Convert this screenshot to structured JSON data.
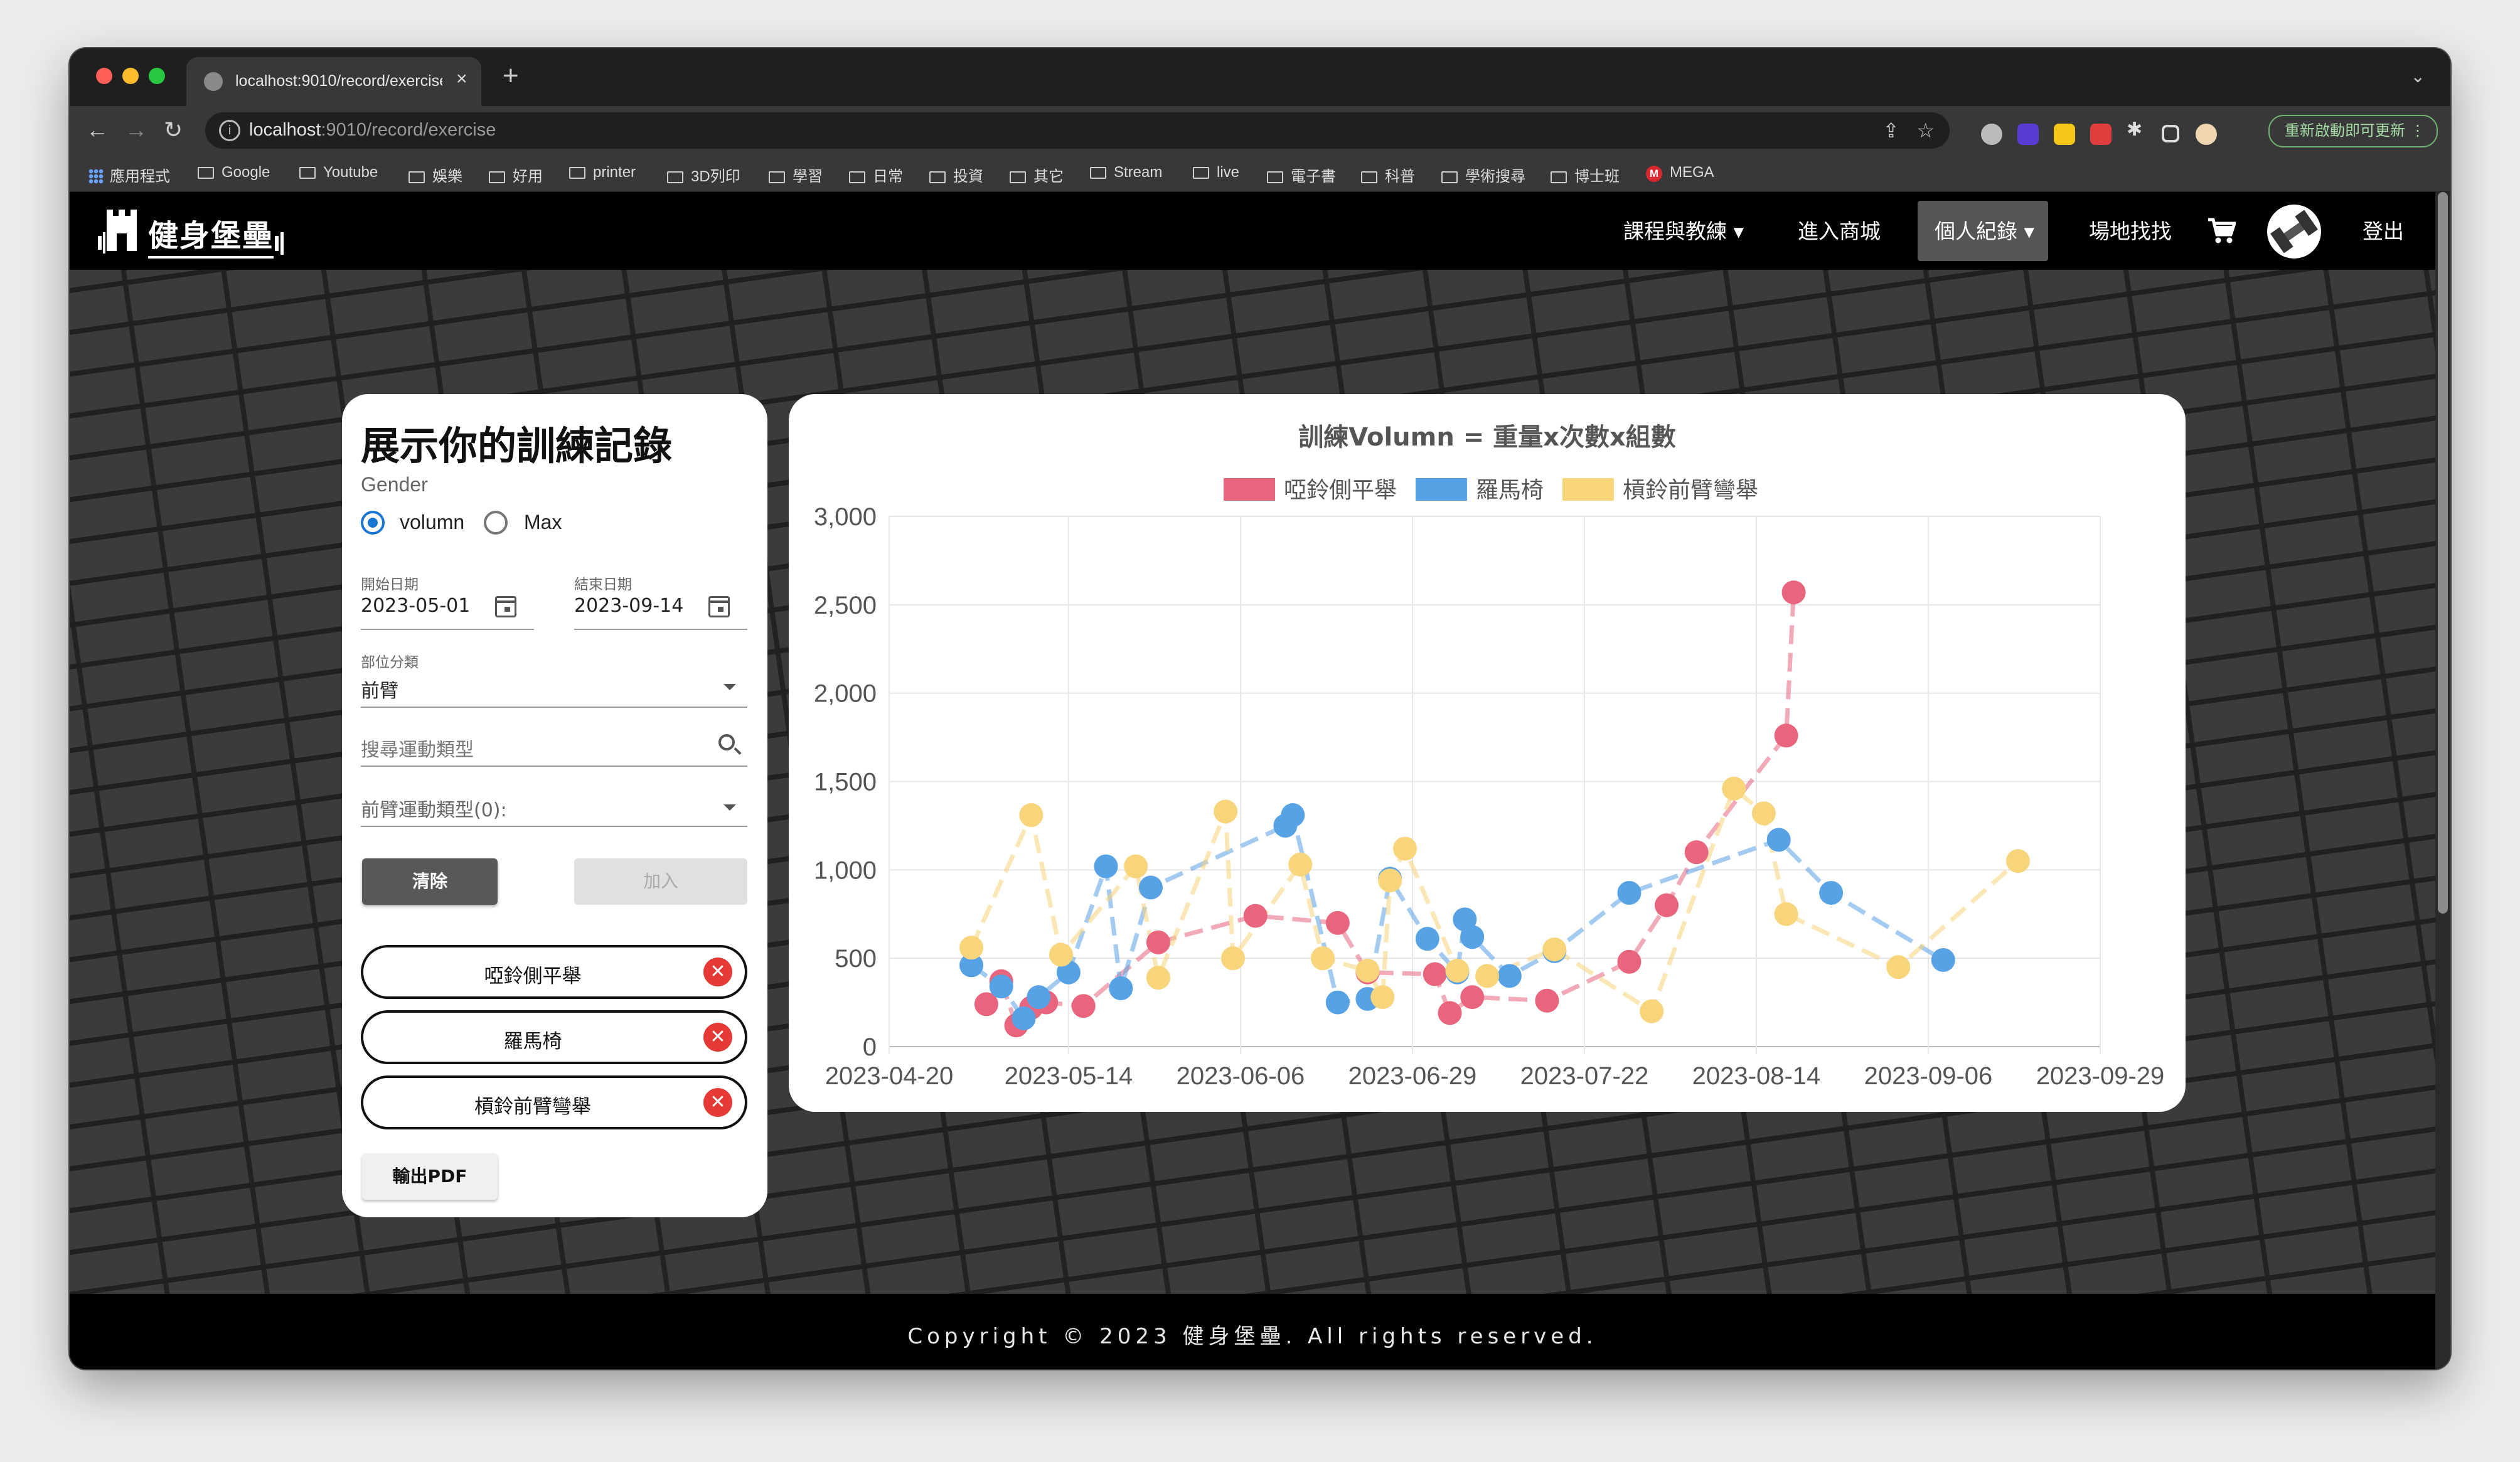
{
  "browser": {
    "tab_title": "localhost:9010/record/exercise",
    "tab_close": "×",
    "new_tab": "+",
    "url_host": "localhost",
    "url_rest": ":9010/record/exercise",
    "update_label": "重新啟動即可更新",
    "bookmarks": [
      "應用程式",
      "Google",
      "Youtube",
      "娛樂",
      "好用",
      "printer",
      "3D列印",
      "學習",
      "日常",
      "投資",
      "其它",
      "Stream",
      "live",
      "電子書",
      "科普",
      "學術搜尋",
      "博士班",
      "MEGA"
    ]
  },
  "site": {
    "logo": "健身堡壘",
    "nav": {
      "courses": "課程與教練 ▾",
      "shop": "進入商城",
      "records": "個人紀錄 ▾",
      "venues": "場地找找",
      "logout": "登出"
    }
  },
  "panel": {
    "title": "展示你的訓練記錄",
    "gender_label": "Gender",
    "radio_volumn": "volumn",
    "radio_max": "Max",
    "selected_mode": "volumn",
    "start_label": "開始日期",
    "start_value": "2023-05-01",
    "end_label": "結束日期",
    "end_value": "2023-09-14",
    "category_label": "部位分類",
    "category_value": "前臂",
    "search_placeholder": "搜尋運動類型",
    "type_select": "前臂運動類型(0):",
    "clear_label": "清除",
    "add_label": "加入",
    "selected": [
      "啞鈴側平舉",
      "羅馬椅",
      "槓鈴前臂彎舉"
    ],
    "remove_icon": "✕",
    "pdf_label": "輸出PDF"
  },
  "footer": {
    "text": "Copyright © 2023 健身堡壘. All rights reserved."
  },
  "chart_data": {
    "type": "line",
    "title": "訓練Volumn = 重量x次數x組數",
    "xlabel": "",
    "ylabel": "",
    "x_ticks": [
      "2023-04-20",
      "2023-05-14",
      "2023-06-06",
      "2023-06-29",
      "2023-07-22",
      "2023-08-14",
      "2023-09-06",
      "2023-09-29"
    ],
    "y_ticks": [
      "0",
      "500",
      "1,000",
      "1,500",
      "2,000",
      "2,500",
      "3,000"
    ],
    "ylim": [
      0,
      3000
    ],
    "xlim": [
      "2023-04-20",
      "2023-09-29"
    ],
    "grid": true,
    "legend_position": "top",
    "series": [
      {
        "name": "啞鈴側平舉",
        "color": "#e8657d",
        "points": [
          [
            "2023-05-03",
            240
          ],
          [
            "2023-05-05",
            370
          ],
          [
            "2023-05-07",
            120
          ],
          [
            "2023-05-09",
            220
          ],
          [
            "2023-05-11",
            250
          ],
          [
            "2023-05-16",
            230
          ],
          [
            "2023-05-26",
            590
          ],
          [
            "2023-06-08",
            740
          ],
          [
            "2023-06-19",
            700
          ],
          [
            "2023-06-23",
            420
          ],
          [
            "2023-07-02",
            410
          ],
          [
            "2023-07-04",
            190
          ],
          [
            "2023-07-07",
            280
          ],
          [
            "2023-07-17",
            260
          ],
          [
            "2023-07-28",
            480
          ],
          [
            "2023-08-02",
            800
          ],
          [
            "2023-08-06",
            1100
          ],
          [
            "2023-08-18",
            1760
          ],
          [
            "2023-08-19",
            2570
          ]
        ]
      },
      {
        "name": "羅馬椅",
        "color": "#57a1e5",
        "points": [
          [
            "2023-05-01",
            460
          ],
          [
            "2023-05-05",
            340
          ],
          [
            "2023-05-08",
            160
          ],
          [
            "2023-05-10",
            280
          ],
          [
            "2023-05-14",
            420
          ],
          [
            "2023-05-19",
            1020
          ],
          [
            "2023-05-21",
            330
          ],
          [
            "2023-05-25",
            900
          ],
          [
            "2023-06-12",
            1250
          ],
          [
            "2023-06-13",
            1310
          ],
          [
            "2023-06-19",
            250
          ],
          [
            "2023-06-23",
            270
          ],
          [
            "2023-06-26",
            950
          ],
          [
            "2023-07-01",
            610
          ],
          [
            "2023-07-05",
            420
          ],
          [
            "2023-07-06",
            720
          ],
          [
            "2023-07-07",
            620
          ],
          [
            "2023-07-12",
            400
          ],
          [
            "2023-07-18",
            540
          ],
          [
            "2023-07-28",
            870
          ],
          [
            "2023-08-17",
            1170
          ],
          [
            "2023-08-24",
            870
          ],
          [
            "2023-09-08",
            490
          ]
        ]
      },
      {
        "name": "槓鈴前臂彎舉",
        "color": "#f8d47a",
        "points": [
          [
            "2023-05-01",
            560
          ],
          [
            "2023-05-09",
            1310
          ],
          [
            "2023-05-13",
            520
          ],
          [
            "2023-05-23",
            1020
          ],
          [
            "2023-05-26",
            390
          ],
          [
            "2023-06-04",
            1330
          ],
          [
            "2023-06-05",
            500
          ],
          [
            "2023-06-14",
            1030
          ],
          [
            "2023-06-17",
            500
          ],
          [
            "2023-06-23",
            430
          ],
          [
            "2023-06-25",
            280
          ],
          [
            "2023-06-26",
            940
          ],
          [
            "2023-06-28",
            1120
          ],
          [
            "2023-07-05",
            430
          ],
          [
            "2023-07-09",
            400
          ],
          [
            "2023-07-18",
            550
          ],
          [
            "2023-07-31",
            200
          ],
          [
            "2023-08-11",
            1460
          ],
          [
            "2023-08-15",
            1320
          ],
          [
            "2023-08-18",
            750
          ],
          [
            "2023-09-02",
            450
          ],
          [
            "2023-09-18",
            1050
          ]
        ]
      }
    ]
  }
}
